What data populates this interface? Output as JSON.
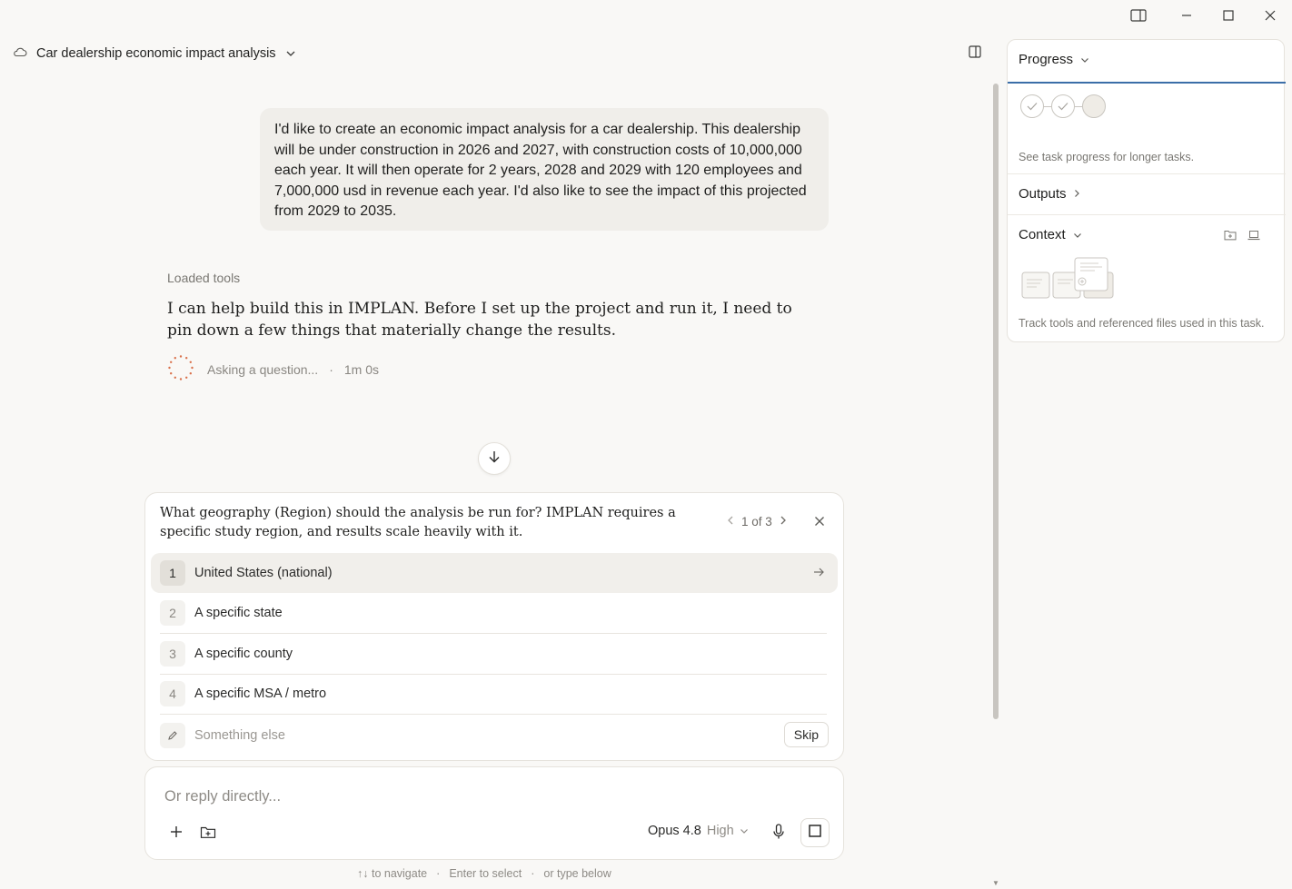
{
  "header": {
    "title": "Car dealership economic impact analysis"
  },
  "user_message": "I'd like to create an economic impact analysis for a car dealership. This dealership will be under construction in 2026 and 2027, with construction costs of 10,000,000 each year. It will then operate for 2 years, 2028 and 2029 with 120 employees and 7,000,000 usd in revenue each year. I'd also like to see the impact of this projected from 2029 to 2035.",
  "assistant": {
    "loaded_tools": "Loaded tools",
    "text": "I can help build this in IMPLAN. Before I set up the project and run it, I need to pin down a few things that materially change the results.",
    "status": "Asking a question...",
    "elapsed": "1m 0s"
  },
  "question": {
    "text": "What geography (Region) should the analysis be run for? IMPLAN requires a specific study region, and results scale heavily with it.",
    "pager": "1 of 3",
    "options": [
      {
        "num": "1",
        "label": "United States (national)"
      },
      {
        "num": "2",
        "label": "A specific state"
      },
      {
        "num": "3",
        "label": "A specific county"
      },
      {
        "num": "4",
        "label": "A specific MSA / metro"
      }
    ],
    "other_placeholder": "Something else",
    "skip_label": "Skip"
  },
  "composer": {
    "placeholder": "Or reply directly...",
    "model": "Opus 4.8",
    "effort": "High"
  },
  "hints": {
    "navigate": "↑↓ to navigate",
    "select": "Enter to select",
    "type": "or type below"
  },
  "side_panel": {
    "progress_title": "Progress",
    "progress_note": "See task progress for longer tasks.",
    "outputs_title": "Outputs",
    "context_title": "Context",
    "context_note": "Track tools and referenced files used in this task."
  },
  "colors": {
    "accent_blue": "#3b6ea8",
    "spinner": "#d9704a",
    "background": "#f9f8f6"
  }
}
